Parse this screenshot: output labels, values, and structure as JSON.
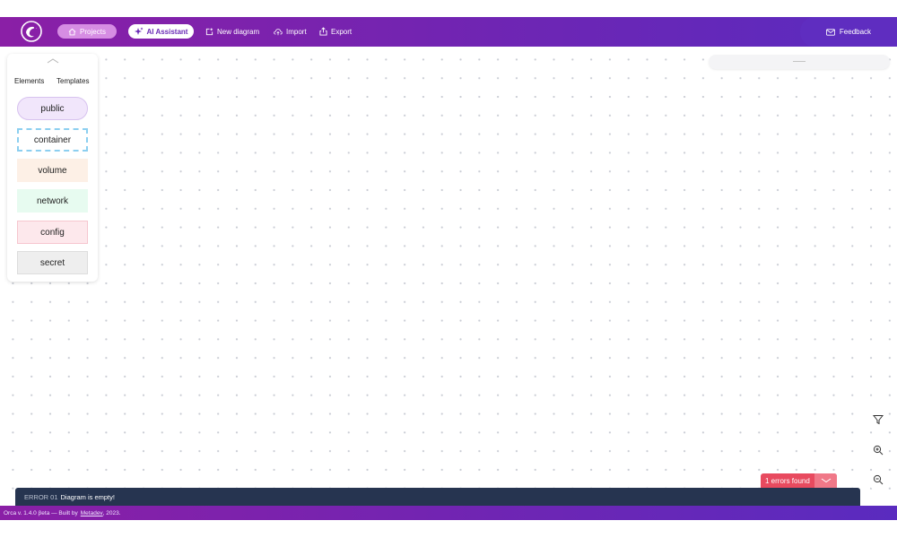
{
  "header": {
    "projects_label": "Projects",
    "ai_label": "AI Assistant",
    "new_diagram_label": "New diagram",
    "import_label": "Import",
    "export_label": "Export",
    "feedback_label": "Feedback",
    "icons": [
      "orca-logo-icon",
      "home-icon",
      "sparkle-icon",
      "new-diagram-icon",
      "cloud-upload-icon",
      "share-icon",
      "mail-icon"
    ],
    "colors": {
      "gradient_start": "#8a1fa6",
      "gradient_end": "#5a2bbf",
      "projects_bg": "#d68de3",
      "ai_text": "#6a2bb6"
    }
  },
  "palette": {
    "tabs": [
      "Elements",
      "Templates"
    ],
    "elements": [
      "public",
      "container",
      "volume",
      "network",
      "config",
      "secret"
    ],
    "colors": {
      "public": "#f1e6fb",
      "container": "#8ccff0",
      "volume": "#fdf0e6",
      "network": "#e7fbf0",
      "config": "#fde8ec",
      "secret": "#eeeeee"
    }
  },
  "tools": {
    "icons": [
      "filter-icon",
      "zoom-in-icon",
      "zoom-out-icon"
    ]
  },
  "errors": {
    "badge_label": "1 errors found",
    "code": "ERROR 01",
    "message": "Diagram is empty!",
    "colors": {
      "badge": "#e84a5f",
      "bar": "#263450"
    }
  },
  "footer": {
    "version_text": "Orca v. 1.4.0 βeta — Built by",
    "link_text": "Metadev",
    "year_text": ", 2023."
  }
}
